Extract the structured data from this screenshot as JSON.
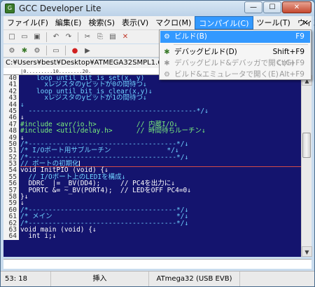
{
  "window": {
    "title": "GCC Developer Lite",
    "minimize_glyph": "—",
    "maximize_glyph": "☐",
    "close_glyph": "✕"
  },
  "menubar": {
    "items": [
      "ファイル(F)",
      "編集(E)",
      "検索(S)",
      "表示(V)",
      "マクロ(M)",
      "コンパイル(C)",
      "ツール(T)",
      "ウィンドウ(W)"
    ],
    "close_glyph": "✕"
  },
  "toolbar": {
    "row1_icons": [
      "new-file-icon",
      "open-folder-icon",
      "save-icon",
      "save-all-icon",
      "undo-icon",
      "redo-icon",
      "cut-icon",
      "copy-icon",
      "paste-icon",
      "paste-special-icon",
      "delete-icon"
    ],
    "row2_icons": [
      "gear-icon",
      "bug-icon",
      "chip-icon",
      "settings-icon",
      "brush-icon",
      "chip-icon",
      "record-icon",
      "play-icon"
    ],
    "glyphs": {
      "new": "□",
      "open": "▭",
      "save": "▣",
      "undo": "↶",
      "redo": "↷",
      "cut": "✂",
      "copy": "⎘",
      "paste": "▤",
      "delete": "✕",
      "gear": "⚙",
      "bug": "✱",
      "record": "●",
      "play": "▶"
    }
  },
  "path": "C:¥Users¥best¥Desktop¥ATMEGA32SMPL1.6¥ATMEGA32",
  "ruler": "|0.........10........20.",
  "editor": {
    "lines": [
      {
        "n": "40",
        "t": "    loop_until_bit_is_set(x, y)",
        "k": "cm"
      },
      {
        "n": "41",
        "t": "      xレジスタのyビットが0の間待つ↓",
        "k": "cm"
      },
      {
        "n": "42",
        "t": "    loop_until_bit_is_clear(x,y)↓",
        "k": "cm"
      },
      {
        "n": "43",
        "t": "      xレジスタのyビットが1の間待つ↓",
        "k": "cm"
      },
      {
        "n": "44",
        "t": "↓",
        "k": "cm"
      },
      {
        "n": "45",
        "t": "  ------------------------------------------*/↓",
        "k": "cm"
      },
      {
        "n": "46",
        "t": "↓",
        "k": "kw"
      },
      {
        "n": "47",
        "t": "#include <avr/io.h>          // 内蔵I/O↓",
        "k": "pp"
      },
      {
        "n": "48",
        "t": "#include <util/delay.h>      // 時間待ちルーチン↓",
        "k": "pp"
      },
      {
        "n": "49",
        "t": "↓",
        "k": "kw"
      },
      {
        "n": "50",
        "t": "/*-------------------------------------*/↓",
        "k": "cm"
      },
      {
        "n": "51",
        "t": "/* I/Oポート用サブルーチン              */↓",
        "k": "cm"
      },
      {
        "n": "52",
        "t": "/*-------------------------------------*/↓",
        "k": "cm"
      },
      {
        "n": "53",
        "t": "// ポートの初期化",
        "k": "cm",
        "current": true
      },
      {
        "n": "54",
        "t": "void InitPIO (void) {↓",
        "k": "kw"
      },
      {
        "n": "55",
        "t": "  // I/Oポート上のLEDIを構成↓",
        "k": "cm"
      },
      {
        "n": "56",
        "t": "  DDRC  |= _BV(DD4);     // PC4を出力に↓",
        "k": "kw"
      },
      {
        "n": "57",
        "t": "  PORTC &= ~_BV(PORT4);  // LEDをOFF PC4=0↓",
        "k": "kw"
      },
      {
        "n": "58",
        "t": "}↓",
        "k": "kw"
      },
      {
        "n": "59",
        "t": "↓",
        "k": "kw"
      },
      {
        "n": "60",
        "t": "/*-------------------------------------*/↓",
        "k": "cm"
      },
      {
        "n": "61",
        "t": "/* メイン                               */↓",
        "k": "cm"
      },
      {
        "n": "62",
        "t": "/*-------------------------------------*/↓",
        "k": "cm"
      },
      {
        "n": "63",
        "t": "void main (void) {↓",
        "k": "kw"
      },
      {
        "n": "64",
        "t": "  int i;↓",
        "k": "kw"
      }
    ]
  },
  "scrollbar": {
    "up_glyph": "▲",
    "down_glyph": "▼"
  },
  "statusbar": {
    "position": "53: 18",
    "mode": "挿入",
    "target": "ATmega32 (USB EVB)"
  },
  "dropdown": {
    "items": [
      {
        "label": "ビルド(B)",
        "shortcut": "F9",
        "icon": "gear-icon",
        "glyph": "⚙",
        "state": "highlight"
      },
      {
        "label": "デバッグビルド(D)",
        "shortcut": "Shift+F9",
        "icon": "bug-icon",
        "glyph": "✱",
        "state": "normal"
      },
      {
        "label": "デバッグビルド&デバッガで開く(G)",
        "shortcut": "Ctrl+F9",
        "icon": "bug-icon",
        "glyph": "✱",
        "state": "disabled"
      },
      {
        "label": "ビルド&エミュレータで開く(E)",
        "shortcut": "Alt+F9",
        "icon": "gear-icon",
        "glyph": "⚙",
        "state": "disabled"
      }
    ]
  }
}
